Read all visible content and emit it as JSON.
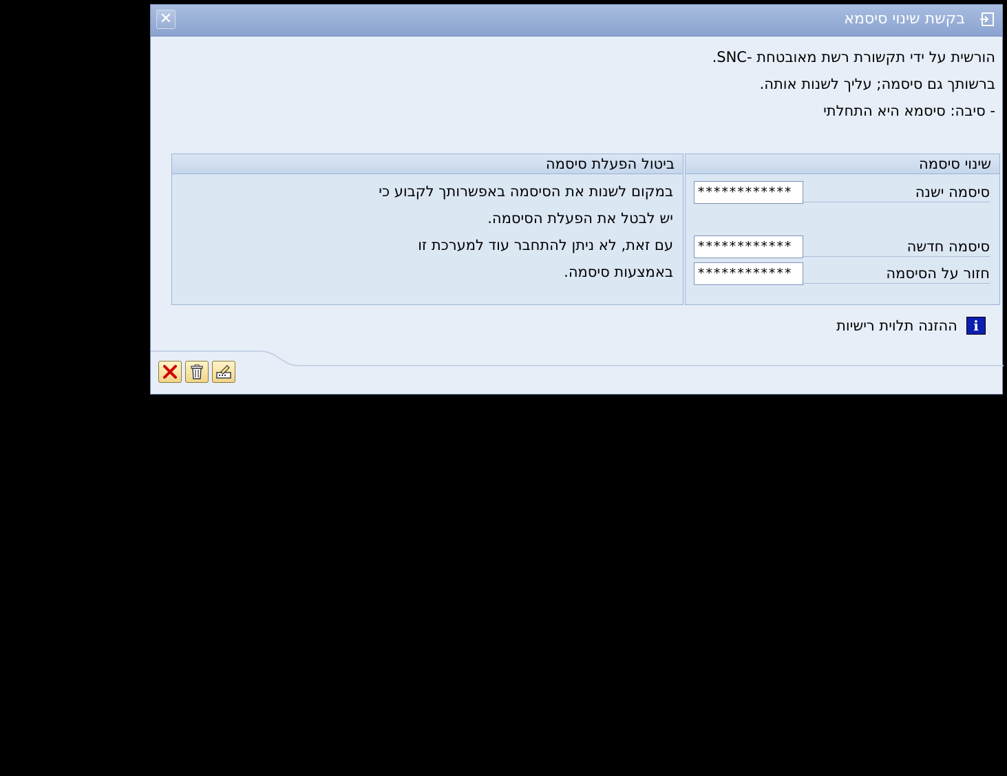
{
  "dialog": {
    "title": "בקשת שינוי סיסמא",
    "close_icon": "close-icon",
    "title_icon": "window-icon"
  },
  "messages": [
    "הורשית על ידי תקשורת רשת מאובטחת -SNC.",
    "ברשותך גם סיסמה; עליך לשנות אותה.",
    "- סיבה: סיסמא היא התחלתי"
  ],
  "change_group": {
    "title": "שינוי סיסמה",
    "old_password_label": "סיסמה ישנה",
    "old_password_value": "************",
    "new_password_label": "סיסמה חדשה",
    "new_password_value": "************",
    "repeat_password_label": "חזור על הסיסמה",
    "repeat_password_value": "************"
  },
  "deactivate_group": {
    "title": "ביטול הפעלת סיסמה",
    "lines": [
      "במקום לשנות את הסיסמה באפשרותך לקבוע כי",
      "יש לבטל את הפעלת הסיסמה.",
      "עם זאת, לא ניתן להתחבר עוד למערכת זו",
      "באמצעות סיסמה."
    ]
  },
  "info": {
    "text": "ההזנה תלוית רישיות",
    "icon": "info-icon"
  },
  "toolbar": {
    "buttons": [
      "cancel-icon",
      "trash-icon",
      "deactivate-password-icon"
    ]
  },
  "colors": {
    "title_bar": "#8aa3cf",
    "dialog_bg": "#e7eef7",
    "group_bg": "#dce7f4",
    "cancel_red": "#d00000",
    "info_blue": "#0c1fb2"
  }
}
